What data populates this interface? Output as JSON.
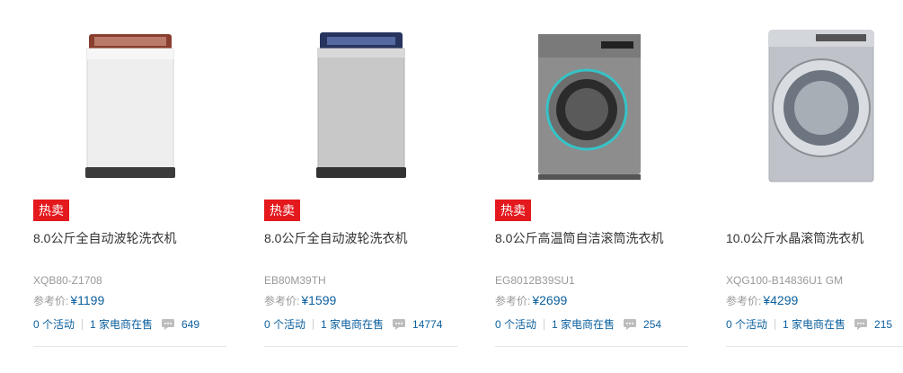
{
  "products": [
    {
      "image": "top-load-washer-white",
      "badge": "热卖",
      "title": "8.0公斤全自动波轮洗衣机",
      "model": "XQB80-Z1708",
      "price_label": "参考价:",
      "price": "¥1199",
      "activities": "0 个活动",
      "sellers": "1 家电商在售",
      "comment_icon": "comment-icon",
      "comments": "649"
    },
    {
      "image": "top-load-washer-silver",
      "badge": "热卖",
      "title": "8.0公斤全自动波轮洗衣机",
      "model": "EB80M39TH",
      "price_label": "参考价:",
      "price": "¥1599",
      "activities": "0 个活动",
      "sellers": "1 家电商在售",
      "comment_icon": "comment-icon",
      "comments": "14774"
    },
    {
      "image": "front-load-washer-silver",
      "badge": "热卖",
      "title": "8.0公斤高温筒自洁滚筒洗衣机",
      "model": "EG8012B39SU1",
      "price_label": "参考价:",
      "price": "¥2699",
      "activities": "0 个活动",
      "sellers": "1 家电商在售",
      "comment_icon": "comment-icon",
      "comments": "254"
    },
    {
      "image": "front-load-washer-crystal",
      "badge": "",
      "title": "10.0公斤水晶滚筒洗衣机",
      "model": "XQG100-B14836U1 GM",
      "price_label": "参考价:",
      "price": "¥4299",
      "activities": "0 个活动",
      "sellers": "1 家电商在售",
      "comment_icon": "comment-icon",
      "comments": "215"
    }
  ],
  "colors": {
    "badge": "#e4191e",
    "link": "#0b5f9d",
    "muted": "#999999"
  }
}
